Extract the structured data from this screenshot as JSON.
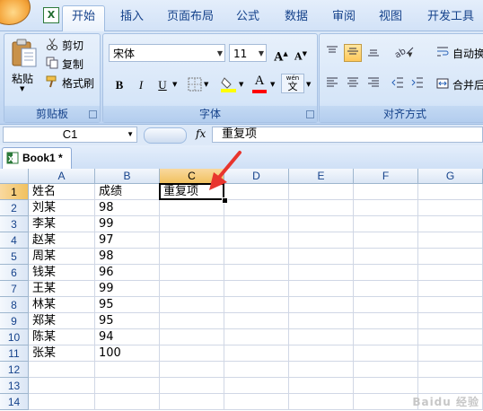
{
  "app": {
    "office_button": "office",
    "excel_icon_letter": "X"
  },
  "tabs": [
    {
      "label": "开始",
      "active": true
    },
    {
      "label": "插入"
    },
    {
      "label": "页面布局"
    },
    {
      "label": "公式"
    },
    {
      "label": "数据"
    },
    {
      "label": "审阅"
    },
    {
      "label": "视图"
    },
    {
      "label": "开发工具"
    }
  ],
  "ribbon": {
    "clipboard": {
      "group_label": "剪贴板",
      "paste_label": "粘贴",
      "cut_label": "剪切",
      "copy_label": "复制",
      "format_painter_label": "格式刷"
    },
    "font": {
      "group_label": "字体",
      "font_name": "宋体",
      "font_size": "11",
      "bold": "B",
      "italic": "I",
      "underline": "U",
      "grow_font": "A",
      "shrink_font": "A",
      "font_color_letter": "A",
      "phonetic_glyph": "wén",
      "phonetic_char": "文",
      "fill_color": "#ffff00",
      "font_color": "#ff0000"
    },
    "alignment": {
      "group_label": "对齐方式",
      "wrap_text_label": "自动换",
      "merge_label": "合并后"
    }
  },
  "formula_bar": {
    "name_box": "C1",
    "fx_label": "fx",
    "content": "重复项"
  },
  "workbook": {
    "tab_label": "Book1 *"
  },
  "grid": {
    "columns": [
      "A",
      "B",
      "C",
      "D",
      "E",
      "F",
      "G"
    ],
    "selected_column": "C",
    "rows": [
      {
        "n": "1",
        "a": "姓名",
        "b": "成绩",
        "c": "重复项"
      },
      {
        "n": "2",
        "a": "刘某",
        "b": "98"
      },
      {
        "n": "3",
        "a": "李某",
        "b": "99"
      },
      {
        "n": "4",
        "a": "赵某",
        "b": "97"
      },
      {
        "n": "5",
        "a": "周某",
        "b": "98"
      },
      {
        "n": "6",
        "a": "钱某",
        "b": "96"
      },
      {
        "n": "7",
        "a": "王某",
        "b": "99"
      },
      {
        "n": "8",
        "a": "林某",
        "b": "95"
      },
      {
        "n": "9",
        "a": "郑某",
        "b": "95"
      },
      {
        "n": "10",
        "a": "陈某",
        "b": "94"
      },
      {
        "n": "11",
        "a": "张某",
        "b": "100"
      },
      {
        "n": "12"
      },
      {
        "n": "13"
      },
      {
        "n": "14"
      }
    ],
    "selected_row": "1"
  },
  "annotation": {
    "arrow_color": "#e8352e"
  },
  "watermark": "Baidu 经验"
}
